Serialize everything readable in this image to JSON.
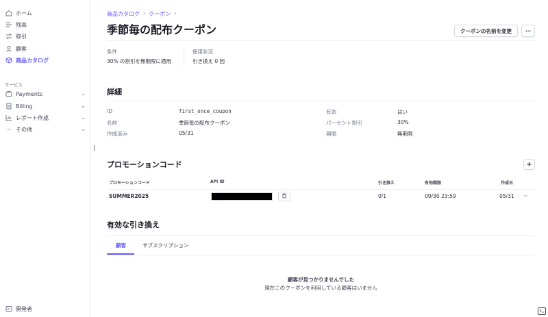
{
  "sidebar": {
    "items": [
      {
        "label": "ホーム",
        "icon": "home-icon"
      },
      {
        "label": "残高",
        "icon": "balance-icon"
      },
      {
        "label": "取引",
        "icon": "transactions-icon"
      },
      {
        "label": "顧客",
        "icon": "customer-icon"
      },
      {
        "label": "商品カタログ",
        "icon": "catalog-icon"
      }
    ],
    "section_label": "サービス",
    "services": [
      {
        "label": "Payments",
        "icon": "payments-icon"
      },
      {
        "label": "Billing",
        "icon": "billing-icon"
      },
      {
        "label": "レポート作成",
        "icon": "report-icon"
      },
      {
        "label": "その他",
        "icon": "more-icon"
      }
    ],
    "developer_label": "開発者"
  },
  "breadcrumb": {
    "items": [
      "商品カタログ",
      "クーポン"
    ]
  },
  "page_title": "季節毎の配布クーポン",
  "actions": {
    "rename_label": "クーポンの名前を変更",
    "more_label": "···"
  },
  "summary": {
    "conditions_label": "条件",
    "conditions_value": "30% の割引を無期限に適用",
    "usage_label": "使用状況",
    "usage_value": "引き換え 0 回"
  },
  "details": {
    "title": "詳細",
    "left": [
      {
        "label": "ID",
        "value": "first_once_coupon"
      },
      {
        "label": "名前",
        "value": "季節毎の配布クーポン"
      },
      {
        "label": "作成済み",
        "value": "05/31"
      }
    ],
    "right": [
      {
        "label": "有効",
        "value": "はい"
      },
      {
        "label": "パーセント割引",
        "value": "30%"
      },
      {
        "label": "期間",
        "value": "無期限"
      }
    ]
  },
  "promo": {
    "title": "プロモーションコード",
    "add_label": "+",
    "columns": [
      "プロモーションコード",
      "API ID",
      "引き換え",
      "有効期限",
      "作成日"
    ],
    "rows": [
      {
        "code": "SUMMER2025",
        "redemptions": "0/1",
        "expires": "09/30 23:59",
        "created": "05/31",
        "more": "···"
      }
    ]
  },
  "redemptions": {
    "title": "有効な引き換え",
    "tabs": [
      "顧客",
      "サブスクリプション"
    ],
    "empty_title": "顧客が見つかりませんでした",
    "empty_body": "現在このクーポンを利用している顧客はいません"
  },
  "colors": {
    "accent": "#635bff",
    "text": "#30313d",
    "muted": "#687385",
    "border": "#ebeef1"
  }
}
